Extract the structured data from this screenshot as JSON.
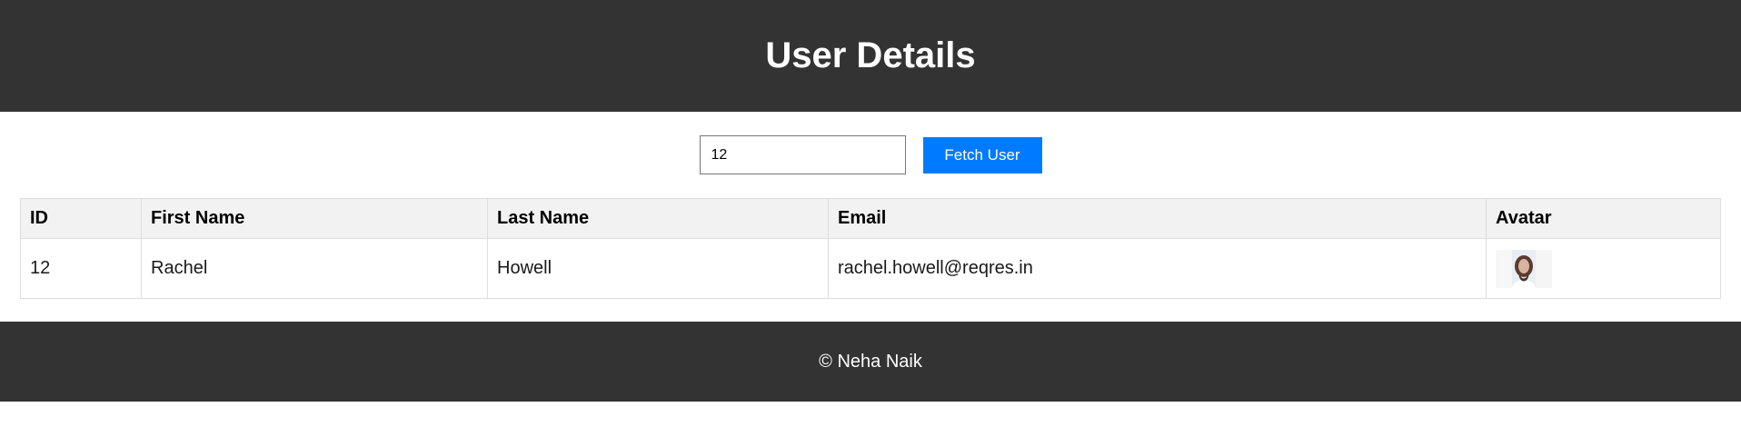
{
  "header": {
    "title": "User Details"
  },
  "controls": {
    "user_id_value": "12",
    "fetch_button_label": "Fetch User"
  },
  "table": {
    "columns": [
      "ID",
      "First Name",
      "Last Name",
      "Email",
      "Avatar"
    ],
    "rows": [
      {
        "id": "12",
        "first_name": "Rachel",
        "last_name": "Howell",
        "email": "rachel.howell@reqres.in",
        "avatar": "user-avatar-photo"
      }
    ]
  },
  "footer": {
    "text": "© Neha Naik"
  },
  "colors": {
    "header_bg": "#333333",
    "button_bg": "#007bff",
    "table_header_bg": "#f2f2f2"
  }
}
